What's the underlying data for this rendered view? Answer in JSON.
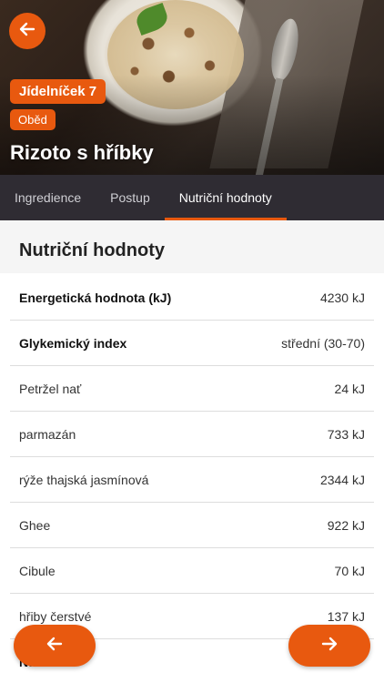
{
  "header": {
    "menu_badge": "Jídelníček 7",
    "meal_badge": "Oběd",
    "title": "Rizoto s hříbky"
  },
  "tabs": [
    {
      "label": "Ingredience",
      "active": false
    },
    {
      "label": "Postup",
      "active": false
    },
    {
      "label": "Nutriční hodnoty",
      "active": true
    }
  ],
  "section": {
    "title": "Nutriční hodnoty"
  },
  "rows": [
    {
      "label": "Energetická hodnota (kJ)",
      "value": "4230 kJ",
      "bold": true
    },
    {
      "label": "Glykemický index",
      "value": "střední (30-70)",
      "bold": true
    },
    {
      "label": "Petržel nať",
      "value": "24 kJ",
      "bold": false
    },
    {
      "label": "parmazán",
      "value": "733 kJ",
      "bold": false
    },
    {
      "label": "rýže thajská jasmínová",
      "value": "2344 kJ",
      "bold": false
    },
    {
      "label": "Ghee",
      "value": "922 kJ",
      "bold": false
    },
    {
      "label": "Cibule",
      "value": "70 kJ",
      "bold": false
    },
    {
      "label": "hřiby čerstvé",
      "value": "137 kJ",
      "bold": false
    },
    {
      "label": "Na",
      "value": "",
      "bold": true
    }
  ],
  "colors": {
    "accent": "#e8590f",
    "tabbar": "#2f2c33"
  },
  "icons": {
    "back": "arrow-left-icon",
    "prev": "arrow-left-icon",
    "next": "arrow-right-icon"
  }
}
